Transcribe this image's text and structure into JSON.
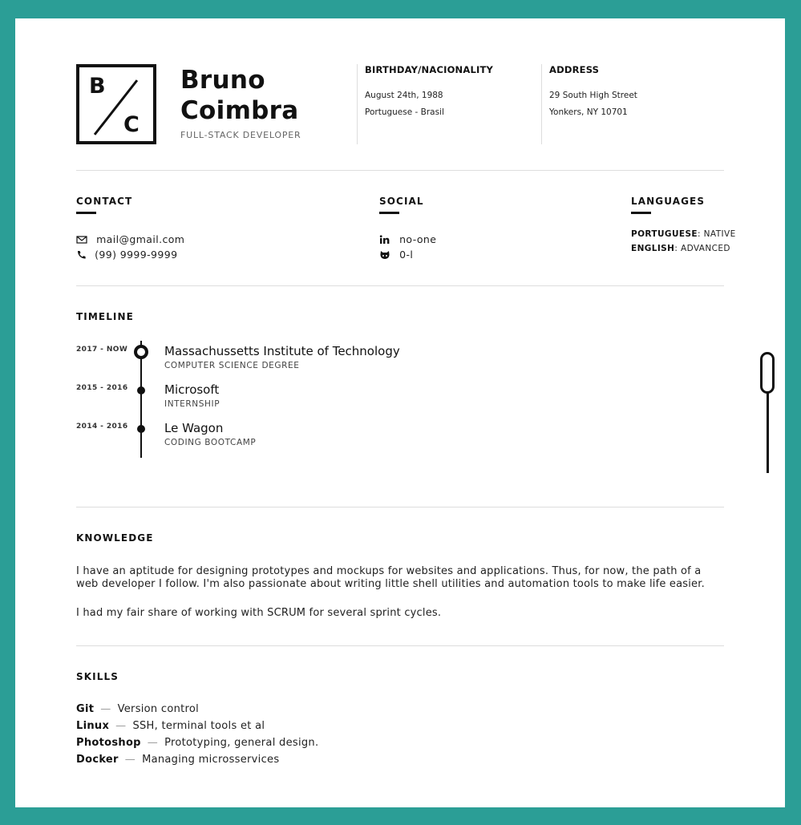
{
  "header": {
    "logo": {
      "letter_top": "B",
      "letter_bottom": "C"
    },
    "first_name": "Bruno",
    "last_name": "Coimbra",
    "role": "FULL-STACK DEVELOPER",
    "birthday": {
      "title": "BIRTHDAY/NACIONALITY",
      "date": "August 24th, 1988",
      "nationality": "Portuguese - Brasil"
    },
    "address": {
      "title": "ADDRESS",
      "line1": "29 South High Street",
      "line2": "Yonkers, NY 10701"
    }
  },
  "contact": {
    "title": "CONTACT",
    "email": "mail@gmail.com",
    "phone": "(99) 9999-9999",
    "icons": [
      "envelope-icon",
      "phone-icon"
    ]
  },
  "social": {
    "title": "SOCIAL",
    "linkedin": "no-one",
    "github": "0-l",
    "icons": [
      "linkedin-icon",
      "github-icon"
    ]
  },
  "languages": {
    "title": "LANGUAGES",
    "items": [
      {
        "name": "PORTUGUESE",
        "level": "NATIVE"
      },
      {
        "name": "ENGLISH",
        "level": "ADVANCED"
      }
    ]
  },
  "timeline": {
    "title": "TIMELINE",
    "items": [
      {
        "dates": "2017 - NOW",
        "title": "Massachussetts Institute of Technology",
        "subtitle": "COMPUTER SCIENCE DEGREE"
      },
      {
        "dates": "2015 - 2016",
        "title": "Microsoft",
        "subtitle": "INTERNSHIP"
      },
      {
        "dates": "2014 - 2016",
        "title": "Le Wagon",
        "subtitle": "CODING BOOTCAMP"
      }
    ]
  },
  "knowledge": {
    "title": "KNOWLEDGE",
    "paragraph1": "I have an aptitude for designing prototypes and mockups for websites and applications. Thus, for now, the path of a web developer I follow. I'm also passionate about writing little shell utilities and automation tools to make life easier.",
    "paragraph2": "I had my fair share of working with SCRUM for several sprint cycles."
  },
  "skills": {
    "title": "SKILLS",
    "separator": "—",
    "items": [
      {
        "name": "Git",
        "description": "Version control"
      },
      {
        "name": "Linux",
        "description": "SSH, terminal tools et al"
      },
      {
        "name": "Photoshop",
        "description": "Prototyping, general design."
      },
      {
        "name": "Docker",
        "description": "Managing microsservices"
      }
    ]
  },
  "colors": {
    "background": "#2b9e96",
    "paper": "#ffffff",
    "ink": "#111111",
    "divider": "#dddddd"
  }
}
